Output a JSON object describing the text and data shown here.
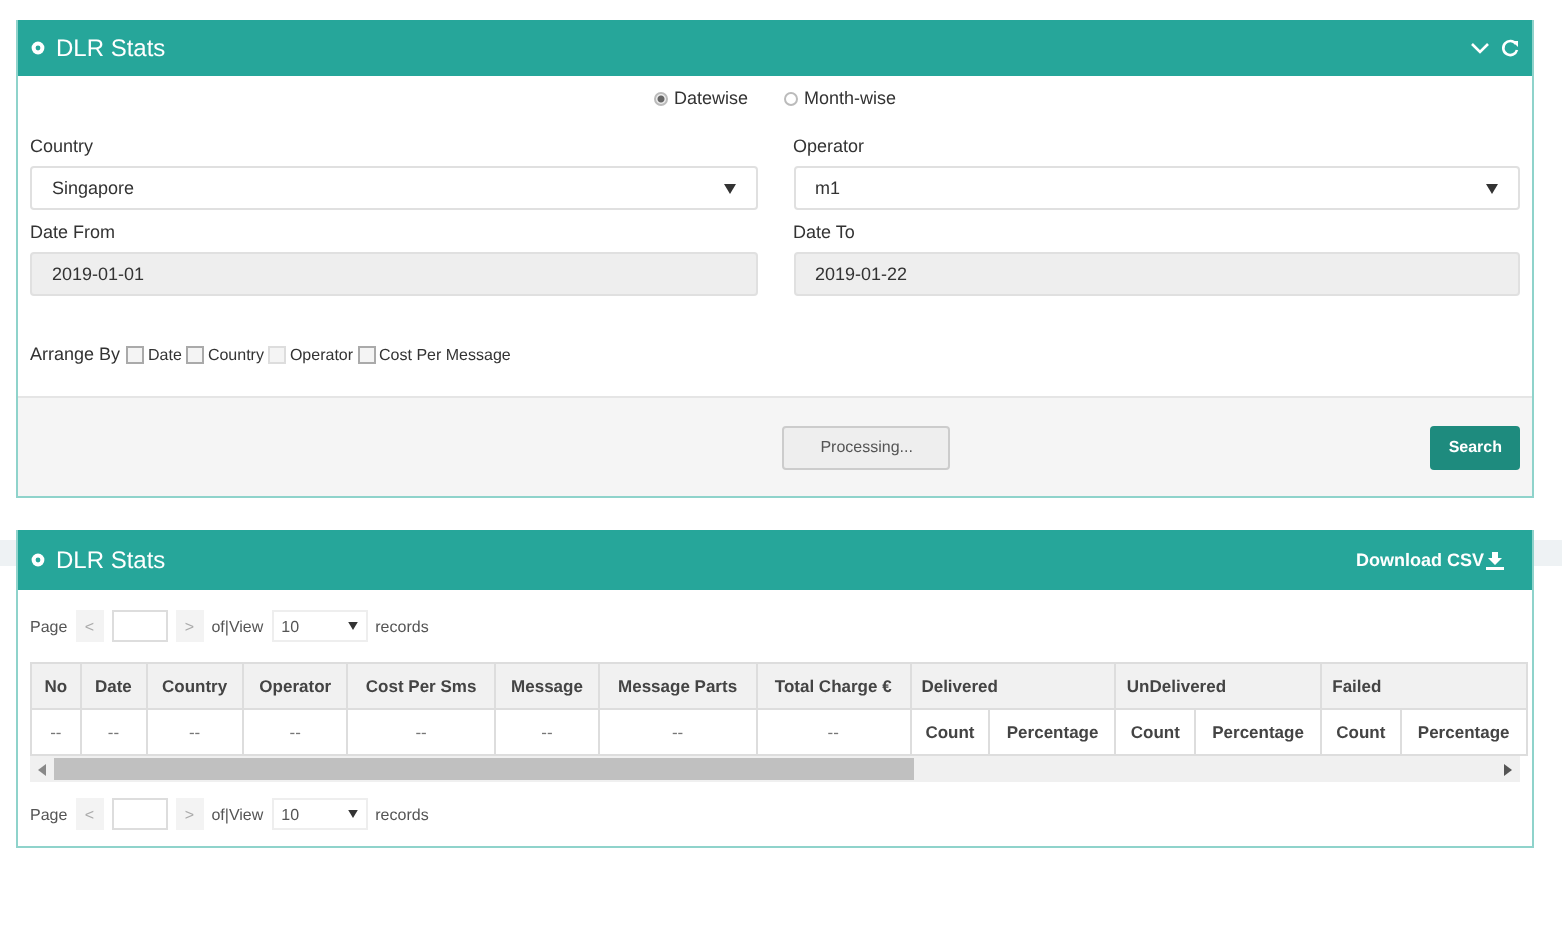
{
  "filter_panel": {
    "title": "DLR Stats",
    "modes": [
      {
        "label": "Datewise",
        "selected": true
      },
      {
        "label": "Month-wise",
        "selected": false
      }
    ],
    "country": {
      "label": "Country",
      "value": "Singapore"
    },
    "operator": {
      "label": "Operator",
      "value": "m1"
    },
    "date_from": {
      "label": "Date From",
      "value": "2019-01-01"
    },
    "date_to": {
      "label": "Date To",
      "value": "2019-01-22"
    },
    "arrange_by": {
      "label": "Arrange By",
      "options": [
        {
          "label": "Date",
          "checked": false,
          "disabled": false
        },
        {
          "label": "Country",
          "checked": false,
          "disabled": false
        },
        {
          "label": "Operator",
          "checked": false,
          "disabled": true
        },
        {
          "label": "Cost Per Message",
          "checked": false,
          "disabled": false
        }
      ]
    },
    "buttons": [
      {
        "label": "Processing...",
        "kind": "busy"
      },
      {
        "label": "Search",
        "kind": "primary"
      }
    ]
  },
  "results_panel": {
    "title": "DLR Stats",
    "download": "Download CSV",
    "paginations": [
      {
        "page_label": "Page",
        "prev": "<",
        "next": ">",
        "of_view": "of|View",
        "per_page": "10",
        "records": "records"
      },
      {
        "page_label": "Page",
        "prev": "<",
        "next": ">",
        "of_view": "of|View",
        "per_page": "10",
        "records": "records"
      }
    ],
    "table": {
      "columns": [
        "No",
        "Date",
        "Country",
        "Operator",
        "Cost Per Sms",
        "Message",
        "Message Parts",
        "Total Charge €"
      ],
      "groups": [
        {
          "label": "Delivered",
          "subcolumns": [
            "Count",
            "Percentage"
          ]
        },
        {
          "label": "UnDelivered",
          "subcolumns": [
            "Count",
            "Percentage"
          ]
        },
        {
          "label": "Failed",
          "subcolumns": [
            "Count",
            "Percentage"
          ]
        }
      ],
      "row": [
        "--",
        "--",
        "--",
        "--",
        "--",
        "--",
        "--",
        "--"
      ]
    }
  }
}
